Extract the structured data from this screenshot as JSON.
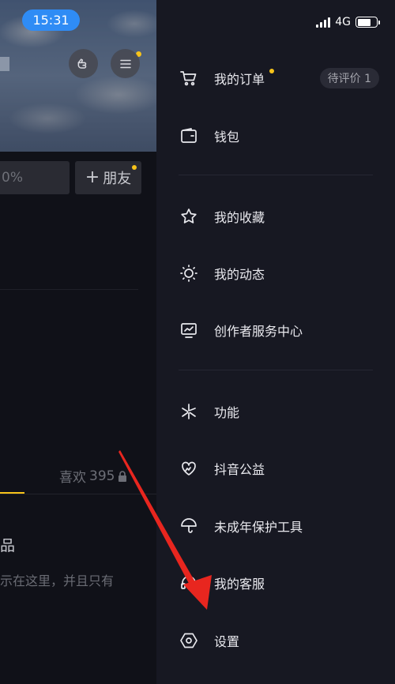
{
  "status_bar": {
    "time": "15:31",
    "network": "4G"
  },
  "profile_page": {
    "percent_fragment": "0%",
    "add_friend_label": "朋友",
    "likes_label": "喜欢",
    "likes_count": "395",
    "works_fragment": "品",
    "hint_fragment": "示在这里，并且只有"
  },
  "drawer": {
    "items": [
      {
        "label": "我的订单",
        "icon": "cart-icon",
        "badge": "待评价 1"
      },
      {
        "label": "钱包",
        "icon": "wallet-icon"
      },
      {
        "label": "我的收藏",
        "icon": "star-icon"
      },
      {
        "label": "我的动态",
        "icon": "sun-icon"
      },
      {
        "label": "创作者服务中心",
        "icon": "chart-monitor-icon"
      },
      {
        "label": "功能",
        "icon": "sparkle-icon"
      },
      {
        "label": "抖音公益",
        "icon": "heart-hand-icon"
      },
      {
        "label": "未成年保护工具",
        "icon": "umbrella-icon"
      },
      {
        "label": "我的客服",
        "icon": "headset-icon"
      },
      {
        "label": "设置",
        "icon": "hexagon-gear-icon"
      }
    ]
  },
  "colors": {
    "accent_yellow": "#f7c31a",
    "time_pill_blue": "#2f8cf5",
    "annotation_red": "#e8261f",
    "drawer_bg": "#171822"
  }
}
